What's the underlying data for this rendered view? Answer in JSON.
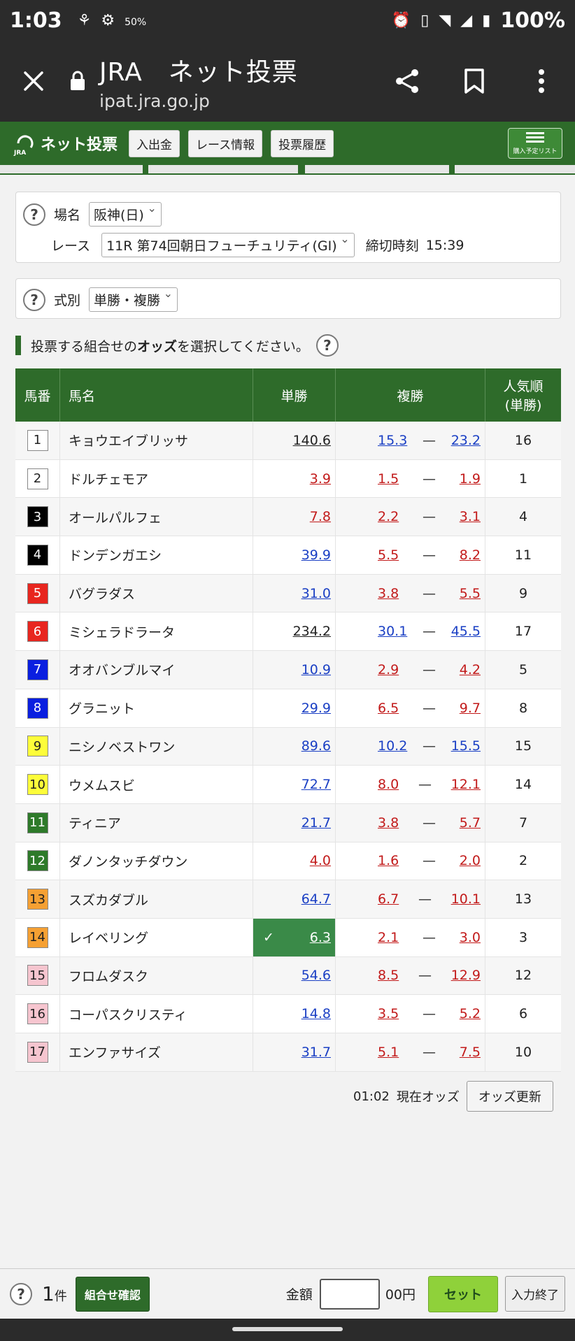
{
  "status_bar": {
    "time": "1:03",
    "battery": "100%",
    "data_saver": "50%"
  },
  "browser": {
    "title": "JRA　ネット投票",
    "url": "ipat.jra.go.jp"
  },
  "jra_nav": {
    "logo_text": "ネット投票",
    "logo_sub": "JRA",
    "buttons": [
      "入出金",
      "レース情報",
      "投票履歴"
    ],
    "cart_label": "購入予定リスト"
  },
  "venue": {
    "label": "場名",
    "value": "阪神(日)"
  },
  "race": {
    "label": "レース",
    "value": "11R 第74回朝日フューチュリティ(GⅠ)",
    "deadline_label": "締切時刻",
    "deadline": "15:39"
  },
  "bet_type": {
    "label": "式別",
    "value": "単勝・複勝"
  },
  "instruction": {
    "before": "投票する組合せの",
    "bold": "オッズ",
    "after": "を選択してください。"
  },
  "table": {
    "headers": {
      "num": "馬番",
      "name": "馬名",
      "win": "単勝",
      "place": "複勝",
      "pop": "人気順\n(単勝)"
    },
    "rows": [
      {
        "num": "1",
        "name": "キョウエイブリッサ",
        "win": "140.6",
        "place_lo": "15.3",
        "place_hi": "23.2",
        "pop": "16",
        "box_bg": "#ffffff",
        "box_fg": "#222222",
        "win_color": "black",
        "place_color": "blue"
      },
      {
        "num": "2",
        "name": "ドルチェモア",
        "win": "3.9",
        "place_lo": "1.5",
        "place_hi": "1.9",
        "pop": "1",
        "box_bg": "#ffffff",
        "box_fg": "#222222",
        "win_color": "red",
        "place_color": "red"
      },
      {
        "num": "3",
        "name": "オールパルフェ",
        "win": "7.8",
        "place_lo": "2.2",
        "place_hi": "3.1",
        "pop": "4",
        "box_bg": "#000000",
        "box_fg": "#ffffff",
        "win_color": "red",
        "place_color": "red"
      },
      {
        "num": "4",
        "name": "ドンデンガエシ",
        "win": "39.9",
        "place_lo": "5.5",
        "place_hi": "8.2",
        "pop": "11",
        "box_bg": "#000000",
        "box_fg": "#ffffff",
        "win_color": "blue",
        "place_color": "red"
      },
      {
        "num": "5",
        "name": "バグラダス",
        "win": "31.0",
        "place_lo": "3.8",
        "place_hi": "5.5",
        "pop": "9",
        "box_bg": "#e8261f",
        "box_fg": "#ffffff",
        "win_color": "blue",
        "place_color": "red"
      },
      {
        "num": "6",
        "name": "ミシェラドラータ",
        "win": "234.2",
        "place_lo": "30.1",
        "place_hi": "45.5",
        "pop": "17",
        "box_bg": "#e8261f",
        "box_fg": "#ffffff",
        "win_color": "black",
        "place_color": "blue"
      },
      {
        "num": "7",
        "name": "オオバンブルマイ",
        "win": "10.9",
        "place_lo": "2.9",
        "place_hi": "4.2",
        "pop": "5",
        "box_bg": "#0a1fe0",
        "box_fg": "#ffffff",
        "win_color": "blue",
        "place_color": "red"
      },
      {
        "num": "8",
        "name": "グラニット",
        "win": "29.9",
        "place_lo": "6.5",
        "place_hi": "9.7",
        "pop": "8",
        "box_bg": "#0a1fe0",
        "box_fg": "#ffffff",
        "win_color": "blue",
        "place_color": "red"
      },
      {
        "num": "9",
        "name": "ニシノベストワン",
        "win": "89.6",
        "place_lo": "10.2",
        "place_hi": "15.5",
        "pop": "15",
        "box_bg": "#fdfd3a",
        "box_fg": "#222222",
        "win_color": "blue",
        "place_color": "blue"
      },
      {
        "num": "10",
        "name": "ウメムスビ",
        "win": "72.7",
        "place_lo": "8.0",
        "place_hi": "12.1",
        "pop": "14",
        "box_bg": "#fdfd3a",
        "box_fg": "#222222",
        "win_color": "blue",
        "place_color": "red"
      },
      {
        "num": "11",
        "name": "ティニア",
        "win": "21.7",
        "place_lo": "3.8",
        "place_hi": "5.7",
        "pop": "7",
        "box_bg": "#2e7a2a",
        "box_fg": "#ffffff",
        "win_color": "blue",
        "place_color": "red"
      },
      {
        "num": "12",
        "name": "ダノンタッチダウン",
        "win": "4.0",
        "place_lo": "1.6",
        "place_hi": "2.0",
        "pop": "2",
        "box_bg": "#2e7a2a",
        "box_fg": "#ffffff",
        "win_color": "red",
        "place_color": "red"
      },
      {
        "num": "13",
        "name": "スズカダブル",
        "win": "64.7",
        "place_lo": "6.7",
        "place_hi": "10.1",
        "pop": "13",
        "box_bg": "#f5a033",
        "box_fg": "#222222",
        "win_color": "blue",
        "place_color": "red"
      },
      {
        "num": "14",
        "name": "レイベリング",
        "win": "6.3",
        "place_lo": "2.1",
        "place_hi": "3.0",
        "pop": "3",
        "box_bg": "#f5a033",
        "box_fg": "#222222",
        "win_color": "red",
        "place_color": "red",
        "selected": true
      },
      {
        "num": "15",
        "name": "フロムダスク",
        "win": "54.6",
        "place_lo": "8.5",
        "place_hi": "12.9",
        "pop": "12",
        "box_bg": "#f6c5cf",
        "box_fg": "#222222",
        "win_color": "blue",
        "place_color": "red"
      },
      {
        "num": "16",
        "name": "コーパスクリスティ",
        "win": "14.8",
        "place_lo": "3.5",
        "place_hi": "5.2",
        "pop": "6",
        "box_bg": "#f6c5cf",
        "box_fg": "#222222",
        "win_color": "blue",
        "place_color": "red"
      },
      {
        "num": "17",
        "name": "エンファサイズ",
        "win": "31.7",
        "place_lo": "5.1",
        "place_hi": "7.5",
        "pop": "10",
        "box_bg": "#f6c5cf",
        "box_fg": "#222222",
        "win_color": "blue",
        "place_color": "red"
      }
    ]
  },
  "odds_footer": {
    "time": "01:02",
    "label": "現在オッズ",
    "refresh": "オッズ更新"
  },
  "bottom": {
    "count": "1",
    "count_unit": "件",
    "confirm": "組合せ確認",
    "amount_label": "金額",
    "amount_value": "",
    "amount_unit": "00円",
    "set": "セット",
    "finish": "入力終了"
  },
  "colors": {
    "jra_green": "#2e6b2a",
    "odds_blue": "#1a3fc4",
    "odds_red": "#c21a1a",
    "selected": "#3a8a48"
  }
}
